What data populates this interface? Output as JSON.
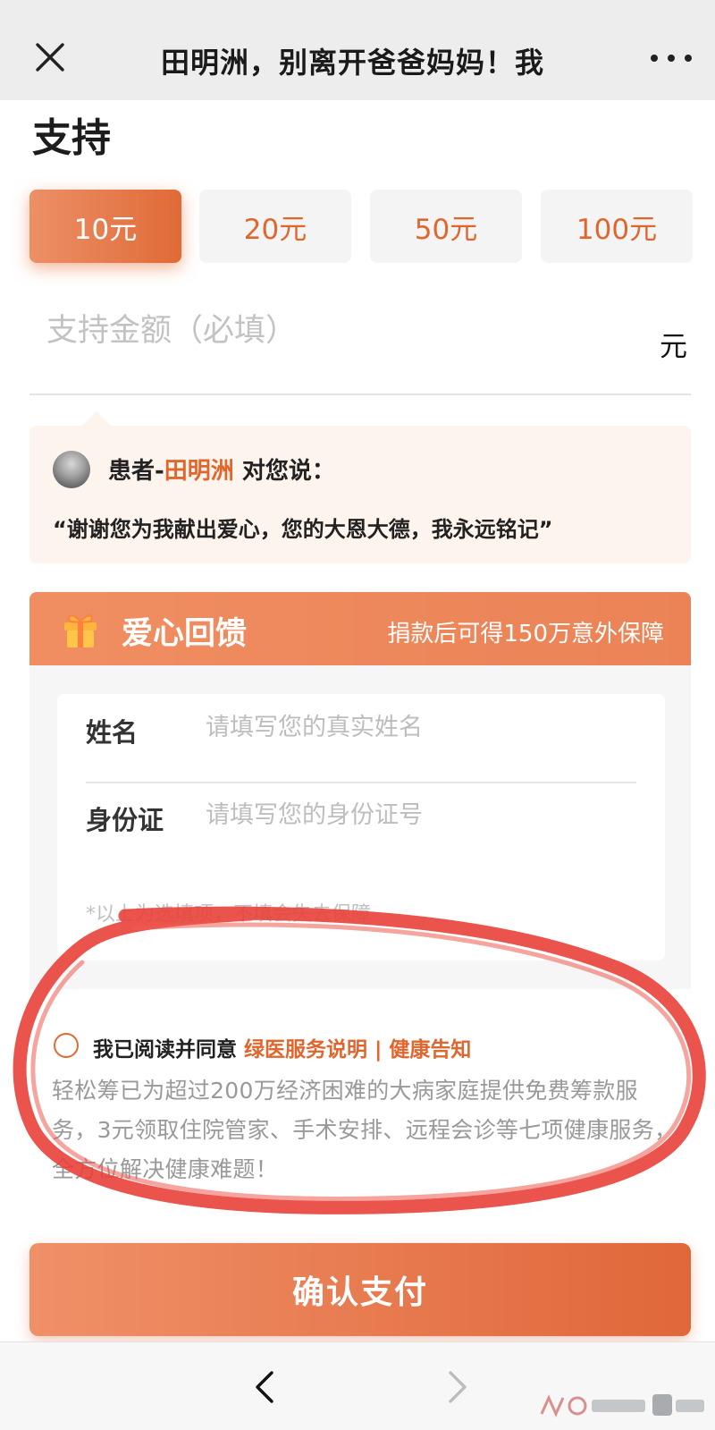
{
  "topbar": {
    "title": "田明洲，别离开爸爸妈妈！我"
  },
  "support": {
    "section_title": "支持",
    "amounts": [
      {
        "label": "10元",
        "selected": true
      },
      {
        "label": "20元",
        "selected": false
      },
      {
        "label": "50元",
        "selected": false
      },
      {
        "label": "100元",
        "selected": false
      }
    ],
    "amount_placeholder": "支持金额（必填）",
    "amount_unit": "元"
  },
  "message": {
    "prefix": "患者-",
    "patient_name": "田明洲",
    "suffix": " 对您说：",
    "text": "“谢谢您为我献出爱心，您的大恩大德，我永远铭记”"
  },
  "feedback": {
    "title": "爱心回馈",
    "subtitle": "捐款后可得150万意外保障",
    "name_label": "姓名",
    "name_placeholder": "请填写您的真实姓名",
    "id_label": "身份证",
    "id_placeholder": "请填写您的身份证号",
    "note": "*以上为选填项，不填会失去保障"
  },
  "agreement": {
    "text": "我已阅读并同意 ",
    "link": "绿医服务说明 | 健康告知",
    "description": "轻松筹已为超过200万经济困难的大病家庭提供免费筹款服务，3元领取住院管家、手术安排、远程会诊等七项健康服务，全方位解决健康难题！"
  },
  "pay_button": "确认支付",
  "colors": {
    "accent": "#e0662e",
    "header_orange": "#f08e62",
    "message_bg": "#fdf4ee",
    "annotation_red": "#e8413a"
  },
  "icons": {
    "close": "close-icon",
    "more": "more-dots-icon",
    "gift": "gift-icon",
    "back": "chevron-left-icon",
    "forward": "chevron-right-icon"
  }
}
